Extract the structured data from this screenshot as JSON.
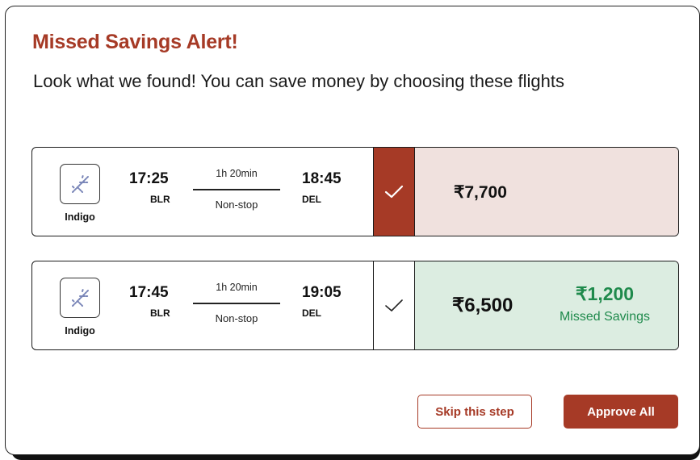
{
  "modal": {
    "title": "Missed Savings Alert!",
    "subtitle": "Look what we found! You can save money by choosing these flights"
  },
  "colors": {
    "brand": "#a63a26",
    "selected_panel": "#f0e1de",
    "savings_panel": "#dcede1",
    "savings_text": "#1f8a4c"
  },
  "flights": [
    {
      "airline": "Indigo",
      "airline_icon": "plane-landing-icon",
      "departure_time": "17:25",
      "departure_code": "BLR",
      "duration": "1h 20min",
      "stops": "Non-stop",
      "arrival_time": "18:45",
      "arrival_code": "DEL",
      "selected": true,
      "select_icon": "checkmark-icon",
      "price": "₹7,700"
    },
    {
      "airline": "Indigo",
      "airline_icon": "plane-landing-icon",
      "departure_time": "17:45",
      "departure_code": "BLR",
      "duration": "1h 20min",
      "stops": "Non-stop",
      "arrival_time": "19:05",
      "arrival_code": "DEL",
      "selected": false,
      "select_icon": "checkmark-icon",
      "price": "₹6,500",
      "savings_amount": "₹1,200",
      "savings_label": "Missed Savings"
    }
  ],
  "actions": {
    "skip_label": "Skip this step",
    "approve_label": "Approve All"
  }
}
